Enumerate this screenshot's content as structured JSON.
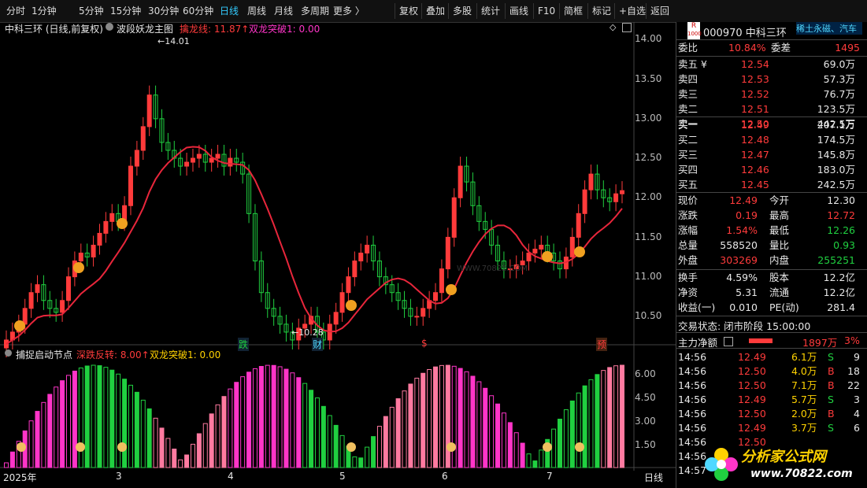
{
  "toolbar": {
    "periods": [
      "分时",
      "1分钟",
      "5分钟",
      "15分钟",
      "30分钟",
      "60分钟",
      "日线",
      "周线",
      "月线",
      "多周期",
      "更多 〉"
    ],
    "active_period": "日线",
    "actions": [
      "复权",
      "叠加",
      "多股",
      "统计",
      "画线",
      "F10",
      "简框",
      "标记",
      "+自选",
      "返回"
    ]
  },
  "main_chart": {
    "title": "中科三环 (日线,前复权)",
    "indicator": "波段妖龙主图",
    "line1_label": "擒龙线: 11.87↑",
    "line2_label": "双龙突破1: 0.00",
    "high_label": "14.01",
    "low_label": "10.28",
    "y_ticks": [
      "14.00",
      "13.50",
      "13.00",
      "12.50",
      "12.00",
      "11.50",
      "11.00",
      "10.50"
    ],
    "markers": [
      "跌",
      "财",
      "$",
      "预"
    ],
    "watermark": "WWW.70822.COM"
  },
  "sub_chart": {
    "title": "捕捉启动节点",
    "line1_label": "深跌反转: 8.00↑",
    "line2_label": "双龙突破1: 0.00",
    "y_ticks": [
      "6.00",
      "4.50",
      "3.00",
      "1.50"
    ]
  },
  "x_axis": {
    "labels": [
      "2025年",
      "3",
      "4",
      "5",
      "6",
      "7"
    ],
    "period_tag": "日线"
  },
  "panel": {
    "logo": "R",
    "logo_sub": "1000",
    "code_name": "000970 中科三环",
    "concept": "稀土永磁、汽车",
    "weibi_label": "委比",
    "weibi": "10.84%",
    "weicha_label": "委差",
    "weicha": "1495",
    "asks": [
      {
        "label": "卖五 ¥",
        "price": "12.54",
        "vol": "69.0万"
      },
      {
        "label": "卖四",
        "price": "12.53",
        "vol": "57.3万"
      },
      {
        "label": "卖三",
        "price": "12.52",
        "vol": "76.7万"
      },
      {
        "label": "卖二",
        "price": "12.51",
        "vol": "123.5万"
      },
      {
        "label": "卖一",
        "price": "12.50",
        "vol": "442.5万"
      }
    ],
    "bids": [
      {
        "label": "买一",
        "price": "12.49",
        "vol": "207.1万"
      },
      {
        "label": "买二",
        "price": "12.48",
        "vol": "174.5万"
      },
      {
        "label": "买三",
        "price": "12.47",
        "vol": "145.8万"
      },
      {
        "label": "买四",
        "price": "12.46",
        "vol": "183.0万"
      },
      {
        "label": "买五",
        "price": "12.45",
        "vol": "242.5万"
      }
    ],
    "quote": [
      {
        "l1": "现价",
        "v1": "12.49",
        "c1": "red",
        "l2": "今开",
        "v2": "12.30",
        "c2": "white"
      },
      {
        "l1": "涨跌",
        "v1": "0.19",
        "c1": "red",
        "l2": "最高",
        "v2": "12.72",
        "c2": "red"
      },
      {
        "l1": "涨幅",
        "v1": "1.54%",
        "c1": "red",
        "l2": "最低",
        "v2": "12.26",
        "c2": "green"
      },
      {
        "l1": "总量",
        "v1": "558520",
        "c1": "white",
        "l2": "量比",
        "v2": "0.93",
        "c2": "green"
      },
      {
        "l1": "外盘",
        "v1": "303269",
        "c1": "red",
        "l2": "内盘",
        "v2": "255251",
        "c2": "green"
      }
    ],
    "stats": [
      {
        "l1": "换手",
        "v1": "4.59%",
        "l2": "股本",
        "v2": "12.2亿"
      },
      {
        "l1": "净资",
        "v1": "5.31",
        "l2": "流通",
        "v2": "12.2亿"
      },
      {
        "l1": "收益(一)",
        "v1": "0.010",
        "l2": "PE(动)",
        "v2": "281.4"
      }
    ],
    "trade_status": "交易状态: 闭市阶段 15:00:00",
    "main_flow_label": "主力净额",
    "main_flow_value": "1897万",
    "main_flow_pct": "3%",
    "ticks": [
      {
        "time": "14:56",
        "price": "12.49",
        "vol": "6.1万",
        "side": "S",
        "n": "9"
      },
      {
        "time": "14:56",
        "price": "12.50",
        "vol": "4.0万",
        "side": "B",
        "n": "18"
      },
      {
        "time": "14:56",
        "price": "12.50",
        "vol": "7.1万",
        "side": "B",
        "n": "22"
      },
      {
        "time": "14:56",
        "price": "12.49",
        "vol": "5.7万",
        "side": "S",
        "n": "3"
      },
      {
        "time": "14:56",
        "price": "12.50",
        "vol": "2.0万",
        "side": "B",
        "n": "4"
      },
      {
        "time": "14:56",
        "price": "12.49",
        "vol": "3.7万",
        "side": "S",
        "n": "6"
      },
      {
        "time": "14:56",
        "price": "12.50",
        "vol": "",
        "side": "",
        "n": ""
      },
      {
        "time": "14:56",
        "price": "",
        "vol": "",
        "side": "",
        "n": ""
      },
      {
        "time": "14:57",
        "price": "",
        "vol": "",
        "side": "",
        "n": ""
      }
    ],
    "brand": "分析家公式网",
    "brand_url": "www.70822.com"
  },
  "colors": {
    "up": "#ff3b3b",
    "down": "#20d040",
    "ma": "#e8263b",
    "ma_down": "#4fd8ff",
    "magenta": "#ff35c8",
    "pink": "#ff7aa0"
  }
}
